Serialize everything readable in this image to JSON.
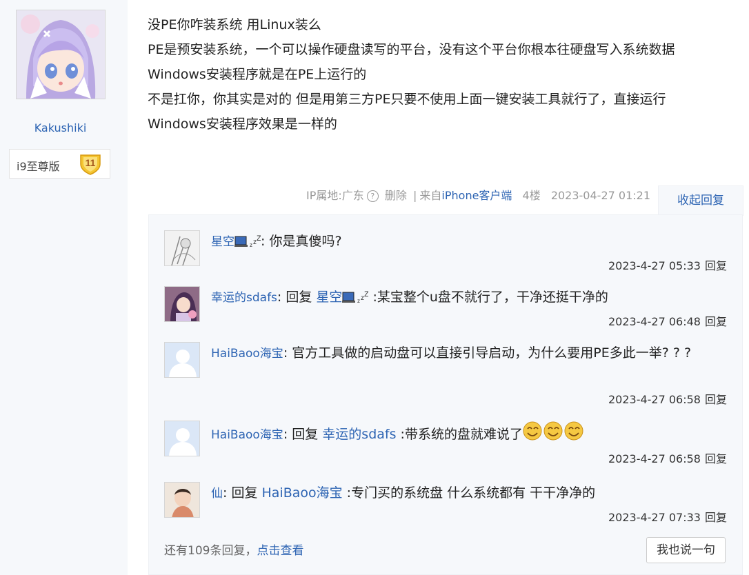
{
  "author": {
    "name": "Kakushiki",
    "badge_label": "i9至尊版",
    "badge_level": "11"
  },
  "post": {
    "lines": [
      "没PE你咋装系统 用Linux装么",
      "PE是预安装系统，一个可以操作硬盘读写的平台，没有这个平台你根本往硬盘写入系统数据",
      "Windows安装程序就是在PE上运行的",
      "不是扛你，你其实是对的 但是用第三方PE只要不使用上面一键安装工具就行了，直接运行",
      "Windows安装程序效果是一样的"
    ]
  },
  "meta": {
    "ip": "IP属地:广东",
    "delete": "删除",
    "sep": "|",
    "from_prefix": "来自",
    "client": "iPhone客户端",
    "floor": "4楼",
    "time": "2023-04-27 01:21",
    "collapse": "收起回复"
  },
  "replies": [
    {
      "user": "星空",
      "reply_word": "",
      "target": "",
      "content": ": 你是真傻吗?",
      "time": "2023-4-27 05:33",
      "reply_label": "回复",
      "user_icons": "💻 zzz"
    },
    {
      "user": "幸运的sdafs",
      "reply_word": ": 回复 ",
      "target": "星空",
      "content": " :某宝整个u盘不就行了，干净还挺干净的",
      "time": "2023-4-27 06:48",
      "reply_label": "回复"
    },
    {
      "user": "HaiBaoo海宝",
      "reply_word": "",
      "target": "",
      "content": ": 官方工具做的启动盘可以直接引导启动，为什么要用PE多此一举? ? ?",
      "time": "2023-4-27 06:58",
      "reply_label": "回复"
    },
    {
      "user": "HaiBaoo海宝",
      "reply_word": ": 回复 ",
      "target": "幸运的sdafs",
      "content": " :带系统的盘就难说了",
      "time": "2023-4-27 06:58",
      "reply_label": "回复"
    },
    {
      "user": "仙",
      "reply_word": ": 回复 ",
      "target": "HaiBaoo海宝",
      "content": " :专门买的系统盘 什么系统都有 干干净净的",
      "time": "2023-4-27 07:33",
      "reply_label": "回复"
    }
  ],
  "more": {
    "prefix": "还有109条回复，",
    "link": "点击查看"
  },
  "say_button": "我也说一句"
}
